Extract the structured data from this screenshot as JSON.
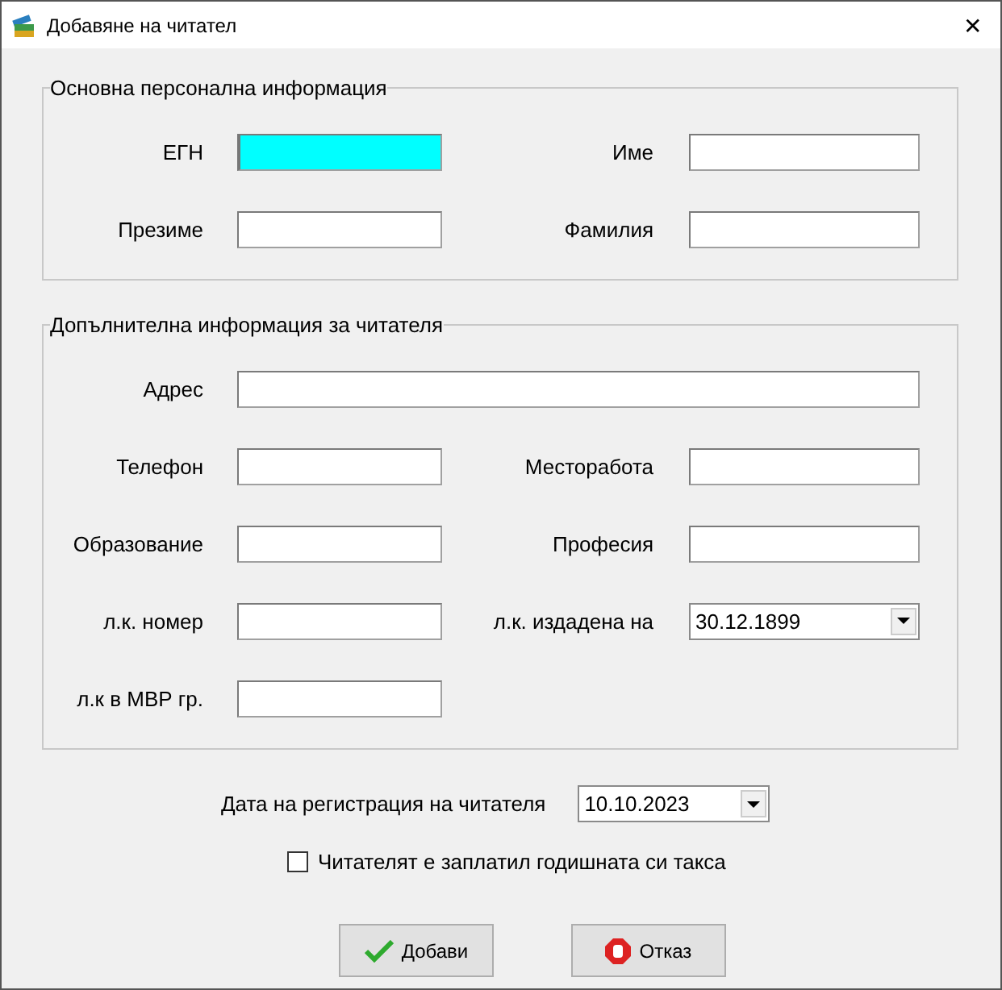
{
  "window": {
    "title": "Добавяне на читател",
    "close": "✕"
  },
  "groups": [
    {
      "title": "Основна персонална информация",
      "rows": [
        [
          {
            "label": "ЕГН",
            "kind": "text",
            "focused": true
          },
          {
            "label": "Име",
            "kind": "text",
            "focused": false
          }
        ],
        [
          {
            "label": "Презиме",
            "kind": "text",
            "focused": false
          },
          {
            "label": "Фамилия",
            "kind": "text",
            "focused": false
          }
        ]
      ]
    },
    {
      "title": "Допълнителна информация за читателя",
      "rows": [
        [
          {
            "label": "Адрес",
            "kind": "wide",
            "focused": false
          }
        ],
        [
          {
            "label": "Телефон",
            "kind": "text",
            "focused": false
          },
          {
            "label": "Месторабота",
            "kind": "text",
            "focused": false
          }
        ],
        [
          {
            "label": "Образование",
            "kind": "text",
            "focused": false
          },
          {
            "label": "Професия",
            "kind": "text",
            "focused": false
          }
        ],
        [
          {
            "label": "л.к. номер",
            "kind": "text",
            "focused": false
          },
          {
            "label": "л.к. издадена на",
            "kind": "date",
            "value": "30.12.1899"
          }
        ],
        [
          {
            "label": "л.к в МВР гр.",
            "kind": "text",
            "focused": false
          }
        ]
      ]
    }
  ],
  "registration": {
    "label": "Дата на регистрация на читателя",
    "value": "10.10.2023"
  },
  "paid": {
    "label": "Читателят е заплатил годишната си такса",
    "checked": false
  },
  "buttons": [
    {
      "label": "Добави",
      "kind": "ok"
    },
    {
      "label": "Отказ",
      "kind": "cancel"
    }
  ]
}
